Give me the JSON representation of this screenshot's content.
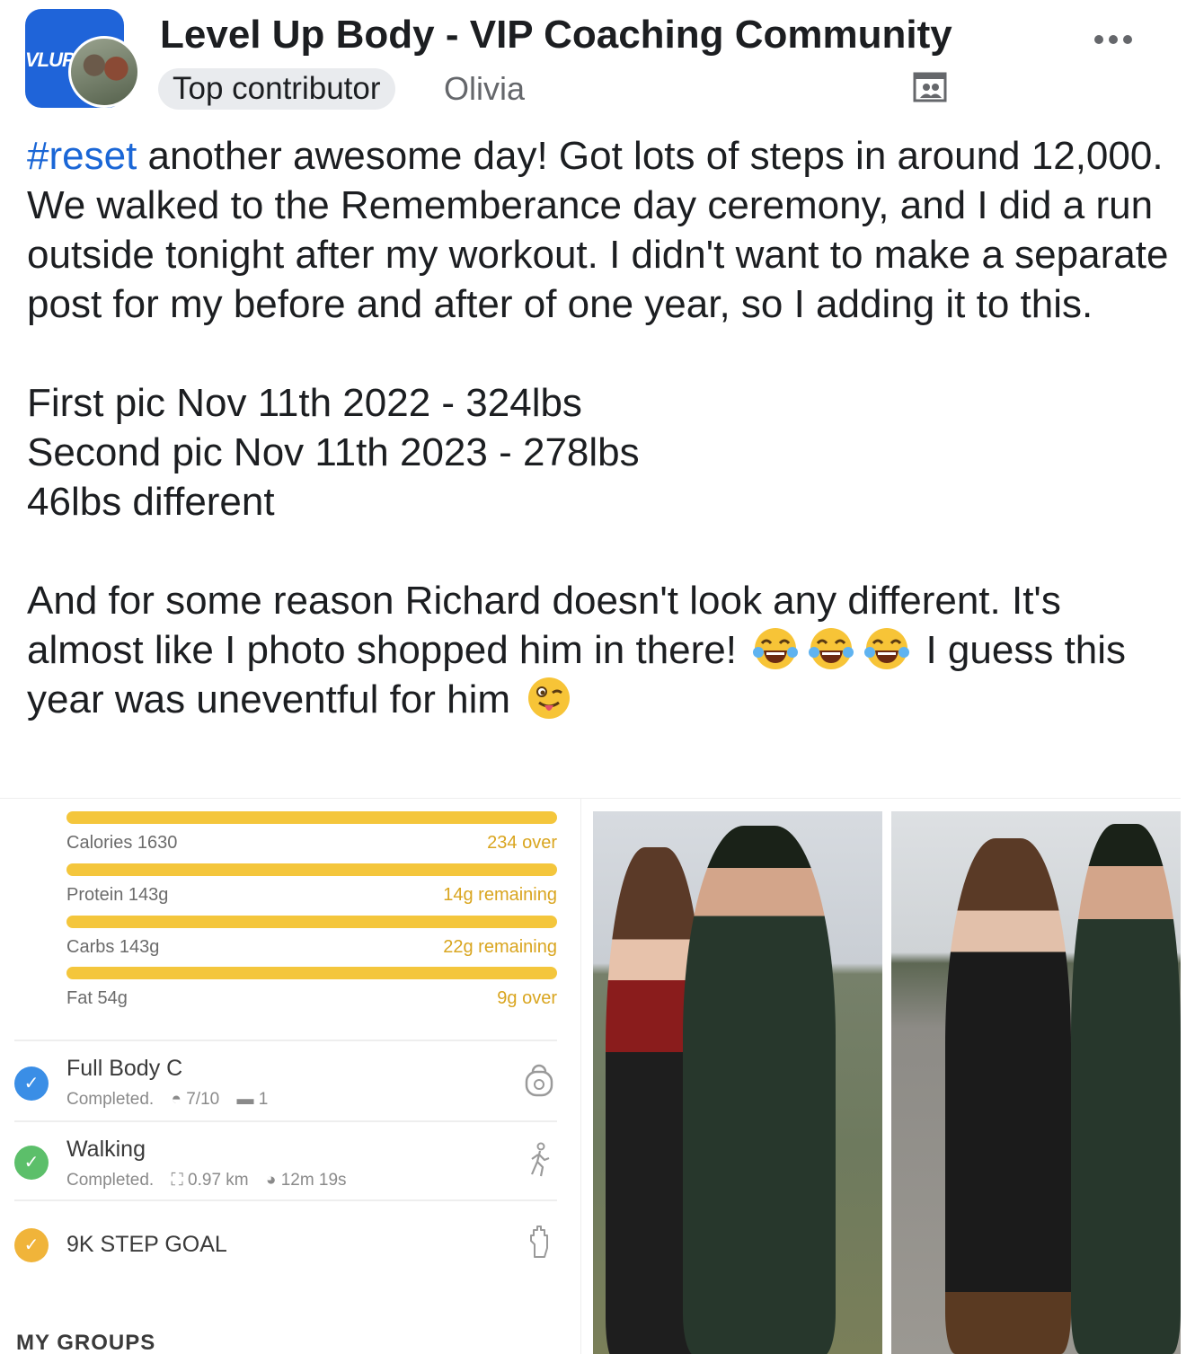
{
  "header": {
    "group_logo_text": "VLUP",
    "group_name": "Level Up Body - VIP Coaching Community",
    "badge": "Top contributor",
    "author": "Olivia"
  },
  "post": {
    "hashtag": "#reset",
    "paragraph1": " another awesome day! Got lots of steps in around 12,000. We walked to the Rememberance day ceremony, and I did a run outside tonight after my workout. I didn't want to make a separate post for my before and after of one year, so I adding it to this.",
    "line_first": "First pic Nov 11th 2022 - 324lbs",
    "line_second": "Second pic Nov 11th 2023 - 278lbs",
    "line_diff": "46lbs different",
    "paragraph3_a": "And for some reason Richard doesn't look any different. It's almost like I photo shopped him in there!",
    "paragraph3_b": "I guess this year was uneventful for him",
    "emojis": [
      "tears-of-joy",
      "tears-of-joy",
      "tears-of-joy",
      "winking-tongue"
    ]
  },
  "tracker": {
    "macros": [
      {
        "name": "Calories 1630",
        "status": "234 over",
        "fill": 1.0
      },
      {
        "name": "Protein 143g",
        "status": "14g remaining",
        "fill": 1.0
      },
      {
        "name": "Carbs 143g",
        "status": "22g remaining",
        "fill": 1.0
      },
      {
        "name": "Fat 54g",
        "status": "9g over",
        "fill": 1.0
      }
    ],
    "activities": [
      {
        "title": "Full Body C",
        "status": "Completed.",
        "meta1": "7/10",
        "meta2": "1",
        "check_color": "#3a8ee6",
        "icon": "kettlebell-icon"
      },
      {
        "title": "Walking",
        "status": "Completed.",
        "meta1": "0.97 km",
        "meta2": "12m 19s",
        "check_color": "#5cbf6a",
        "icon": "walking-icon"
      },
      {
        "title": "9K STEP GOAL",
        "check_color": "#f0b43a",
        "icon": "hand-icon"
      }
    ],
    "groups_label": "MY GROUPS"
  },
  "colors": {
    "hashtag": "#1a66d6",
    "macro_bar": "#f4c63c",
    "group_logo_bg": "#1f64d9"
  }
}
